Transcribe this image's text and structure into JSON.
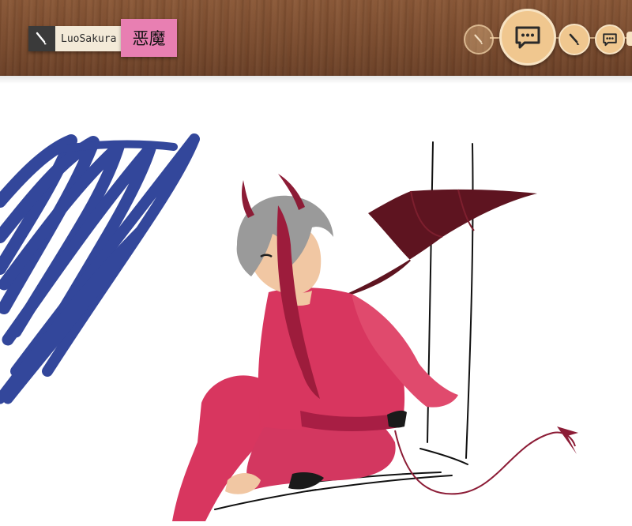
{
  "header": {
    "user_name": "LuoSakura",
    "tag": "恶魔"
  },
  "toolbar": {
    "items": [
      {
        "name": "brush-tool-inactive",
        "icon": "brush-icon",
        "state": "inactive"
      },
      {
        "name": "chat-button-active",
        "icon": "chat-bubble-icon",
        "state": "active"
      },
      {
        "name": "brush-tool",
        "icon": "brush-icon",
        "state": "normal"
      },
      {
        "name": "chat-button",
        "icon": "chat-bubble-icon",
        "state": "normal"
      }
    ]
  },
  "canvas": {
    "description_icon": "drawing-canvas"
  },
  "colors": {
    "wood": "#7a4c2f",
    "accent": "#f0c78f",
    "tag": "#e87fb2",
    "blue_stroke": "#33479b",
    "outfit": "#d8365f",
    "wing": "#5e1420"
  }
}
